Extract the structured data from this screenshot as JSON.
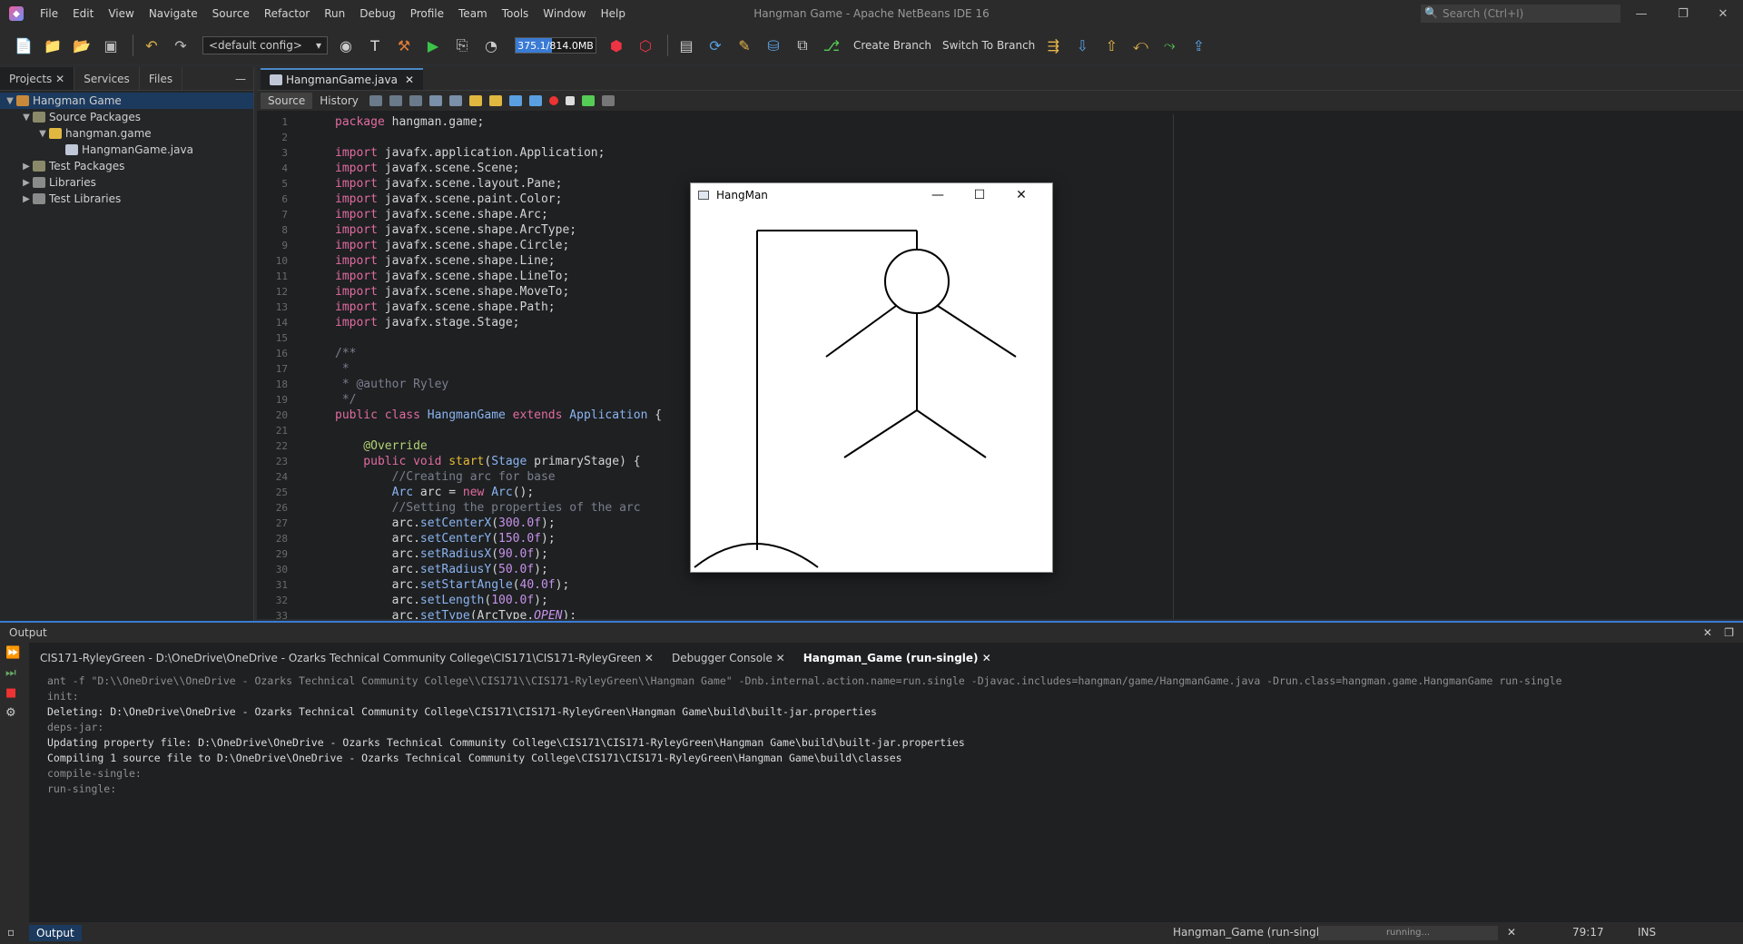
{
  "window": {
    "title": "Hangman Game - Apache NetBeans IDE 16",
    "search_placeholder": "Search (Ctrl+I)"
  },
  "menu": [
    "File",
    "Edit",
    "View",
    "Navigate",
    "Source",
    "Refactor",
    "Run",
    "Debug",
    "Profile",
    "Team",
    "Tools",
    "Window",
    "Help"
  ],
  "toolbar": {
    "config": "<default config>",
    "memory": "375.1/814.0MB",
    "memory_fraction": 0.46,
    "create_branch": "Create Branch",
    "switch_branch": "Switch To Branch"
  },
  "projects": {
    "tabs": [
      "Projects",
      "Services",
      "Files"
    ],
    "tree": [
      {
        "label": "Hangman Game"
      },
      {
        "label": "Source Packages"
      },
      {
        "label": "hangman.game"
      },
      {
        "label": "HangmanGame.java"
      },
      {
        "label": "Test Packages"
      },
      {
        "label": "Libraries"
      },
      {
        "label": "Test Libraries"
      }
    ]
  },
  "editor": {
    "tab": "HangmanGame.java",
    "source_label": "Source",
    "history_label": "History",
    "line_numbers": [
      "1",
      "2",
      "3",
      "4",
      "5",
      "6",
      "7",
      "8",
      "9",
      "10",
      "11",
      "12",
      "13",
      "14",
      "15",
      "16",
      "17",
      "18",
      "19",
      "20",
      "21",
      "22",
      "23",
      "24",
      "25",
      "26",
      "27",
      "28",
      "29",
      "30",
      "31",
      "32",
      "33"
    ]
  },
  "output": {
    "title": "Output",
    "tabs": [
      "CIS171-RyleyGreen - D:\\OneDrive\\OneDrive - Ozarks Technical Community College\\CIS171\\CIS171-RyleyGreen",
      "Debugger Console",
      "Hangman_Game (run-single)"
    ],
    "lines": [
      "ant -f \"D:\\\\OneDrive\\\\OneDrive - Ozarks Technical Community College\\\\CIS171\\\\CIS171-RyleyGreen\\\\Hangman Game\" -Dnb.internal.action.name=run.single -Djavac.includes=hangman/game/HangmanGame.java -Drun.class=hangman.game.HangmanGame run-single",
      "init:",
      "Deleting: D:\\OneDrive\\OneDrive - Ozarks Technical Community College\\CIS171\\CIS171-RyleyGreen\\Hangman Game\\build\\built-jar.properties",
      "deps-jar:",
      "Updating property file: D:\\OneDrive\\OneDrive - Ozarks Technical Community College\\CIS171\\CIS171-RyleyGreen\\Hangman Game\\build\\built-jar.properties",
      "Compiling 1 source file to D:\\OneDrive\\OneDrive - Ozarks Technical Community College\\CIS171\\CIS171-RyleyGreen\\Hangman Game\\build\\classes",
      "compile-single:",
      "run-single:"
    ]
  },
  "status": {
    "output_button": "Output",
    "task": "Hangman_Game (run-single)",
    "progress": "running...",
    "position": "79:17",
    "mode": "INS"
  },
  "fx_window": {
    "title": "HangMan"
  },
  "code": {
    "l1": "package",
    "l1b": " hangman.game;",
    "imp": "import",
    "l3": " javafx.application.Application;",
    "l4": " javafx.scene.Scene;",
    "l5": " javafx.scene.layout.Pane;",
    "l6": " javafx.scene.paint.Color;",
    "l7": " javafx.scene.shape.Arc;",
    "l8": " javafx.scene.shape.ArcType;",
    "l9": " javafx.scene.shape.Circle;",
    "l10": " javafx.scene.shape.Line;",
    "l11": " javafx.scene.shape.LineTo;",
    "l12": " javafx.scene.shape.MoveTo;",
    "l13": " javafx.scene.shape.Path;",
    "l14": " javafx.stage.Stage;",
    "l16": "/**",
    "l17": " *",
    "l18": " * @author Ryley",
    "l19": " */",
    "l20a": "public class ",
    "l20b": "HangmanGame",
    "l20c": " extends ",
    "l20d": "Application",
    "l20e": " {",
    "l22": "    @Override",
    "l23a": "    public void ",
    "l23b": "start",
    "l23c": "(",
    "l23d": "Stage",
    "l23e": " primaryStage) {",
    "l24": "        //Creating arc for base",
    "l25a": "        ",
    "l25b": "Arc",
    "l25c": " arc = ",
    "l25d": "new",
    "l25e": " ",
    "l25f": "Arc",
    "l25g": "();",
    "l26": "        //Setting the properties of the arc",
    "l27a": "        arc.",
    "l27b": "setCenterX",
    "l27c": "(",
    "l27d": "300.0f",
    "l27e": ");",
    "l28b": "setCenterY",
    "l28d": "150.0f",
    "l29b": "setRadiusX",
    "l29d": "90.0f",
    "l30b": "setRadiusY",
    "l30d": "50.0f",
    "l31b": "setStartAngle",
    "l31d": "40.0f",
    "l32b": "setLength",
    "l32d": "100.0f",
    "l33b": "setType",
    "l33c": "(ArcType.",
    "l33d": "OPEN",
    "l33e": ");"
  }
}
